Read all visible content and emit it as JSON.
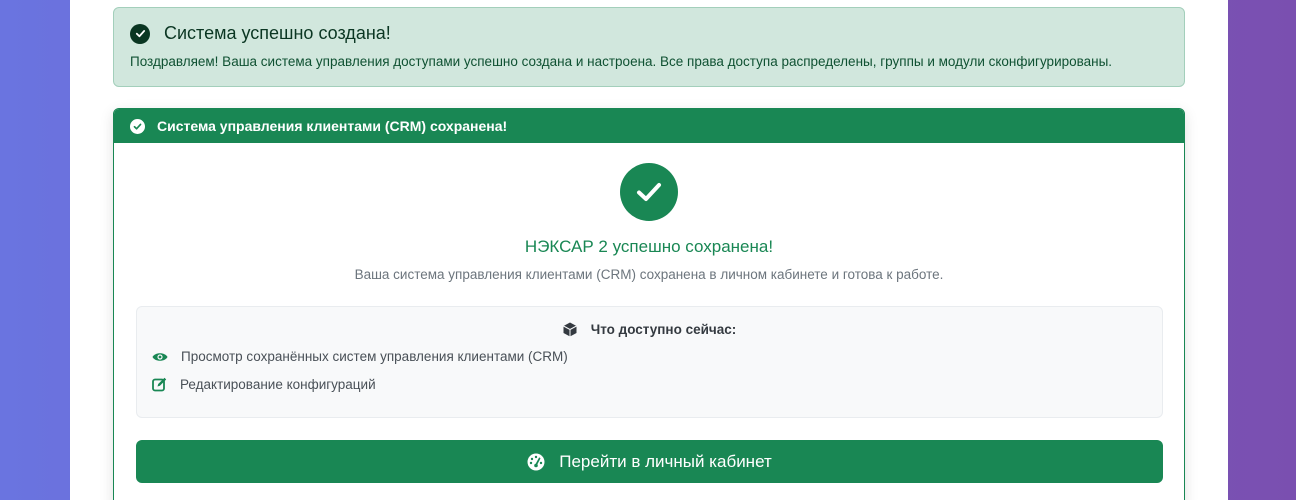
{
  "alert": {
    "title": "Система успешно создана!",
    "text": "Поздравляем! Ваша система управления доступами успешно создана и настроена. Все права доступа распределены, группы и модули сконфигурированы."
  },
  "card": {
    "header": "Система управления клиентами (CRM) сохранена!",
    "success_title": "НЭКСАР 2 успешно сохранена!",
    "success_subtitle": "Ваша система управления клиентами (CRM) сохранена в личном кабинете и готова к работе.",
    "features_title": "Что доступно сейчас:",
    "features": [
      {
        "icon": "eye-icon",
        "label": "Просмотр сохранённых систем управления клиентами (CRM)"
      },
      {
        "icon": "edit-icon",
        "label": "Редактирование конфигураций"
      }
    ],
    "cta_label": "Перейти в личный кабинет"
  },
  "colors": {
    "accent": "#198754",
    "alert_bg": "#d1e7dd",
    "alert_text": "#0f5132",
    "background_gradient": [
      "#6a74e0",
      "#7a4fb0"
    ]
  }
}
